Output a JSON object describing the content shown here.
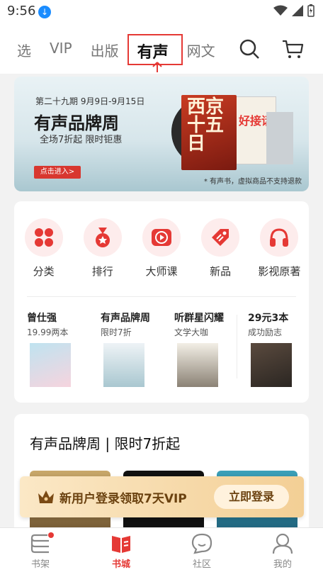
{
  "status_bar": {
    "time": "9:56"
  },
  "top_nav": {
    "tabs": [
      {
        "label": "选"
      },
      {
        "label": "VIP"
      },
      {
        "label": "出版"
      },
      {
        "label": "有声",
        "active": true
      },
      {
        "label": "网文"
      }
    ]
  },
  "banner": {
    "line1": "第二十九期 9月9日-9月15日",
    "title": "有声品牌周",
    "subtitle": "全场7折起 限时钜惠",
    "cta": "点击进入>",
    "note": "* 有声书，虚拟商品不支持退款",
    "book1_title": "西京十五日",
    "book2_title": "好接话"
  },
  "categories": [
    {
      "label": "分类",
      "icon": "grid-icon"
    },
    {
      "label": "排行",
      "icon": "medal-icon"
    },
    {
      "label": "大师课",
      "icon": "play-icon"
    },
    {
      "label": "新品",
      "icon": "tag-icon"
    },
    {
      "label": "影视原著",
      "icon": "headphones-icon"
    }
  ],
  "recommendations": [
    {
      "title": "曾仕强",
      "subtitle": "19.99两本"
    },
    {
      "title": "有声品牌周",
      "subtitle": "限时7折"
    },
    {
      "title": "听群星闪耀",
      "subtitle": "文学大咖"
    },
    {
      "title": "29元3本",
      "subtitle": "成功励志"
    }
  ],
  "section": {
    "title": "有声品牌周 | 限时7折起"
  },
  "vip_bar": {
    "text": "新用户登录领取7天VIP",
    "button": "立即登录"
  },
  "bottom_nav": [
    {
      "label": "书架"
    },
    {
      "label": "书城",
      "active": true
    },
    {
      "label": "社区"
    },
    {
      "label": "我的"
    }
  ],
  "colors": {
    "accent": "#e53935",
    "vip_text": "#6b4210"
  }
}
